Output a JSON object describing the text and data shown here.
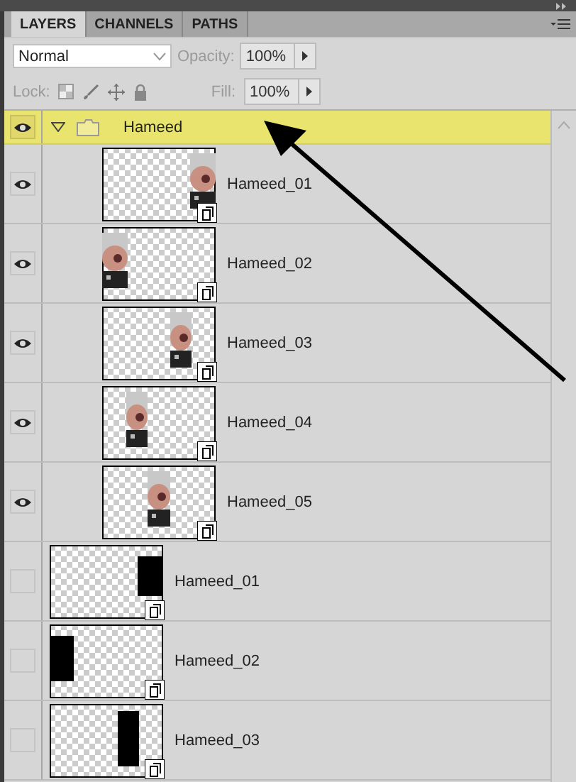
{
  "panel": {
    "tabs": [
      {
        "label": "LAYERS",
        "selected": true
      },
      {
        "label": "CHANNELS",
        "selected": false
      },
      {
        "label": "PATHS",
        "selected": false
      }
    ],
    "blend_mode": "Normal",
    "opacity": {
      "label": "Opacity:",
      "value": "100%",
      "disabled": true
    },
    "lock": {
      "label": "Lock:",
      "disabled": true
    },
    "fill": {
      "label": "Fill:",
      "value": "100%",
      "disabled": true
    }
  },
  "layers": [
    {
      "kind": "group",
      "name": "Hameed",
      "visible": true,
      "selected": true,
      "expanded": true,
      "children": [
        {
          "kind": "picture",
          "name": "Hameed_01",
          "visible": true,
          "selected": false
        },
        {
          "kind": "picture",
          "name": "Hameed_02",
          "visible": true,
          "selected": false
        },
        {
          "kind": "picture",
          "name": "Hameed_03",
          "visible": true,
          "selected": false
        },
        {
          "kind": "picture",
          "name": "Hameed_04",
          "visible": true,
          "selected": false
        },
        {
          "kind": "picture",
          "name": "Hameed_05",
          "visible": true,
          "selected": false
        }
      ]
    },
    {
      "kind": "mask",
      "name": "Hameed_01",
      "visible": false,
      "selected": false
    },
    {
      "kind": "mask",
      "name": "Hameed_02",
      "visible": false,
      "selected": false
    },
    {
      "kind": "mask",
      "name": "Hameed_03",
      "visible": false,
      "selected": false
    }
  ]
}
